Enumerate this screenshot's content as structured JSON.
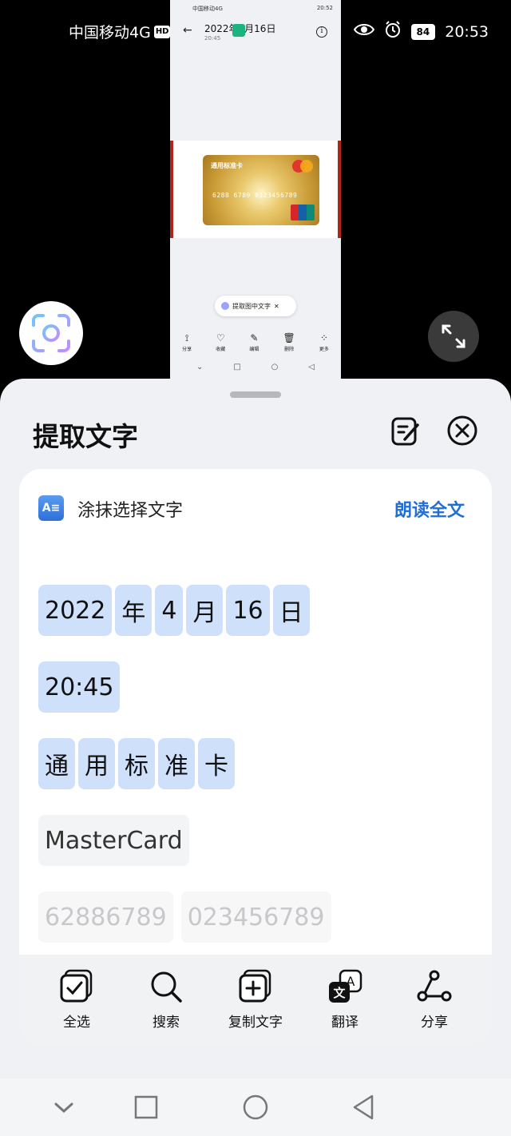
{
  "status_bar": {
    "carrier": "中国移动4G",
    "hd": "HD",
    "battery": "84",
    "time": "20:53"
  },
  "preview": {
    "status_left": "中国移动4G",
    "status_time": "20:52",
    "title": "2022年4月16日",
    "subtitle": "20:45",
    "card_title": "通用标准卡",
    "card_number": "6288 6789 0123456789",
    "pill_text": "提取图中文字",
    "toolbar": [
      "分享",
      "收藏",
      "编辑",
      "删除",
      "更多"
    ]
  },
  "sheet": {
    "title": "提取文字",
    "smear_label": "涂抹选择文字",
    "read_all": "朗读全文",
    "lines": [
      [
        "2022",
        "年",
        "4",
        "月",
        "16",
        "日"
      ],
      [
        "20:45"
      ],
      [
        "通",
        "用",
        "标",
        "准",
        "卡"
      ],
      [
        "MasterCard"
      ],
      [
        "62886789",
        "023456789"
      ]
    ],
    "actions": [
      "全选",
      "搜索",
      "复制文字",
      "翻译",
      "分享"
    ]
  },
  "colors": {
    "accent": "#1f6fd6",
    "chip_selected": "#cfe0fb",
    "card_border": "#b0261c"
  }
}
